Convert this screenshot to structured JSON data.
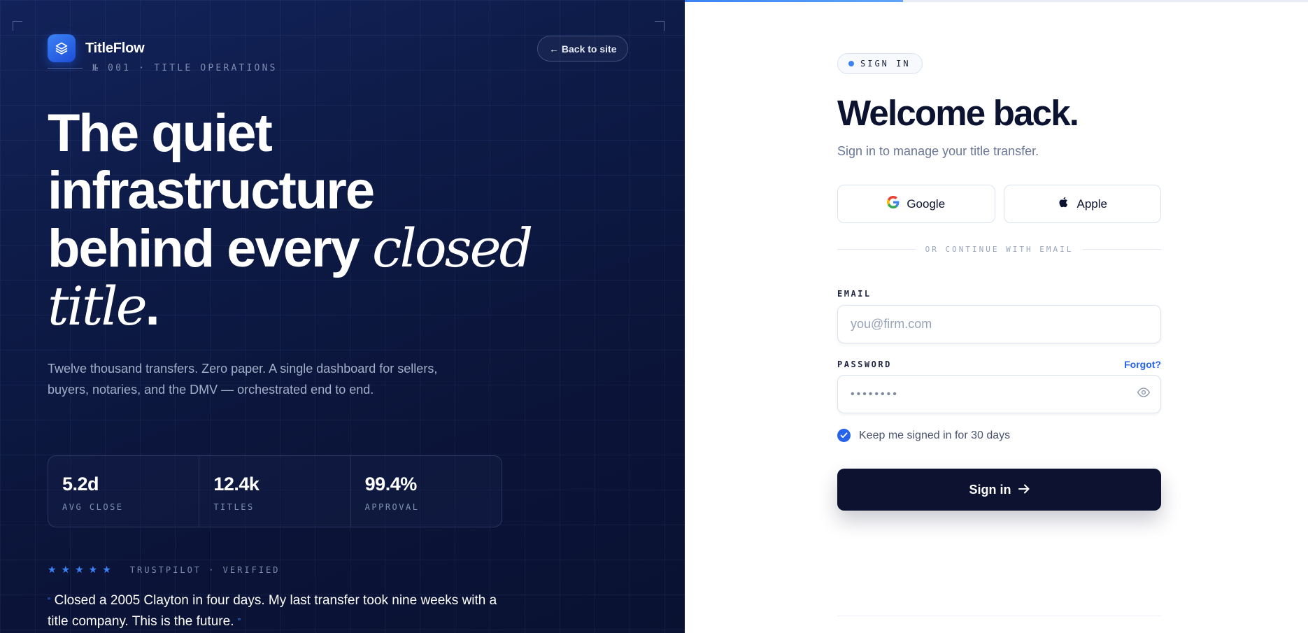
{
  "brand": {
    "name": "TitleFlow",
    "icon": "layers-icon",
    "accent": "#3b82f6"
  },
  "hero": {
    "back_label": "← Back to site",
    "meta": "№ 001 · TITLE OPERATIONS",
    "headline_main": "The quiet infrastructure behind every ",
    "headline_italic1": "closed",
    "headline_space": " ",
    "headline_italic2": "title",
    "headline_end": ".",
    "subcopy": "Twelve thousand transfers. Zero paper. A single dashboard for sellers, buyers, notaries, and the DMV — orchestrated end to end.",
    "stats": [
      {
        "value": "5.2d",
        "label": "AVG CLOSE"
      },
      {
        "value": "12.4k",
        "label": "TITLES"
      },
      {
        "value": "99.4%",
        "label": "APPROVAL"
      }
    ],
    "rating_stars": "★★★★★",
    "trust_text": "TRUSTPILOT · VERIFIED",
    "quote_open": "“",
    "quote": " Closed a 2005 Clayton in four days. My last transfer took nine weeks with a title company. This is the future. ",
    "quote_close": "”"
  },
  "signin": {
    "progress_fraction": 0.35,
    "badge": "SIGN IN",
    "title": "Welcome back.",
    "subtitle": "Sign in to manage your title transfer.",
    "google_label": "Google",
    "apple_label": "Apple",
    "divider_text": "OR CONTINUE WITH EMAIL",
    "email_label": "EMAIL",
    "email_placeholder": "you@firm.com",
    "password_label": "PASSWORD",
    "forgot_label": "Forgot?",
    "password_value": "••••••••",
    "remember_label": "Keep me signed in for 30 days",
    "remember_checked": true,
    "submit_label": "Sign in"
  }
}
